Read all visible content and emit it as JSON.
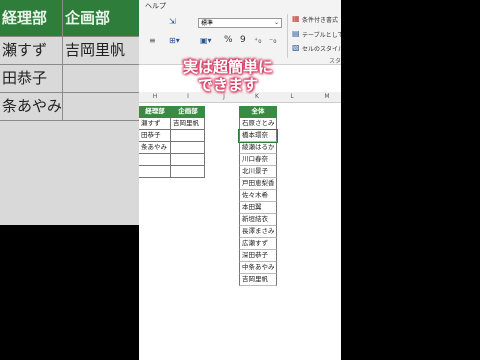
{
  "ribbon": {
    "menu_help": "ヘルプ",
    "number_format": "標準",
    "cond_format": "条件付き書式",
    "table_format": "テーブルとして",
    "cell_style": "セルのスタイル",
    "styles_group": "スタイ",
    "percent_symbol": "%",
    "comma_symbol": "9"
  },
  "left_zoom": {
    "headers": [
      "経理部",
      "企画部"
    ],
    "rows": [
      [
        "瀬すず",
        "吉岡里帆"
      ],
      [
        "田恭子",
        ""
      ],
      [
        "条あやみ",
        ""
      ]
    ]
  },
  "columns": [
    "H",
    "I",
    "J",
    "K",
    "L",
    "M"
  ],
  "small_table": {
    "headers": [
      "経理部",
      "企画部"
    ],
    "rows": [
      [
        "瀬すず",
        "吉岡里帆"
      ],
      [
        "田恭子",
        ""
      ],
      [
        "条あやみ",
        ""
      ],
      [
        "",
        ""
      ],
      [
        "",
        ""
      ]
    ]
  },
  "all_table": {
    "header": "全体",
    "names": [
      "石原さとみ",
      "橋本環奈",
      "綾瀬はるか",
      "川口春奈",
      "北川景子",
      "戸田恵梨香",
      "佐々木希",
      "本田翼",
      "新垣結衣",
      "長澤まさみ",
      "広瀬すず",
      "深田恭子",
      "中条あやみ",
      "吉岡里帆"
    ]
  },
  "caption": {
    "line1": "実は超簡単に",
    "line2": "できます"
  }
}
